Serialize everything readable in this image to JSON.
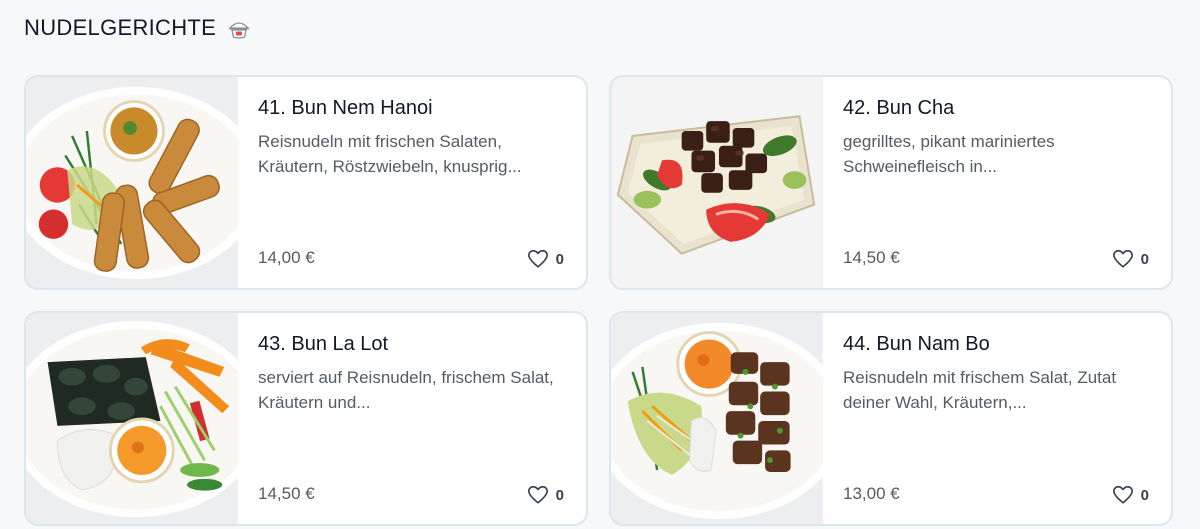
{
  "section": {
    "title": "NUDELGERICHTE",
    "icon": "noodle-bowl-icon"
  },
  "items": [
    {
      "title": "41. Bun Nem Hanoi",
      "description": "Reisnudeln mit frischen Salaten, Kräutern, Röstzwiebeln, knusprig...",
      "price": "14,00 €",
      "likes": "0",
      "image": "bun-nem-spring-rolls-plate"
    },
    {
      "title": "42. Bun Cha",
      "description": "gegrilltes, pikant mariniertes Schweinefleisch in...",
      "price": "14,50 €",
      "likes": "0",
      "image": "bun-cha-grilled-pork-plate"
    },
    {
      "title": "43. Bun La Lot",
      "description": "serviert auf Reisnudeln, frischem Salat, Kräutern und...",
      "price": "14,50 €",
      "likes": "0",
      "image": "bun-la-lot-wrapped-beef-plate"
    },
    {
      "title": "44. Bun Nam Bo",
      "description": "Reisnudeln mit frischem Salat, Zutat deiner Wahl, Kräutern,...",
      "price": "13,00 €",
      "likes": "0",
      "image": "bun-nam-bo-beef-plate"
    }
  ],
  "colors": {
    "background": "#f7f8fa",
    "card_border": "#dbe6f0",
    "text_primary": "#111827",
    "text_secondary": "#555b66"
  }
}
